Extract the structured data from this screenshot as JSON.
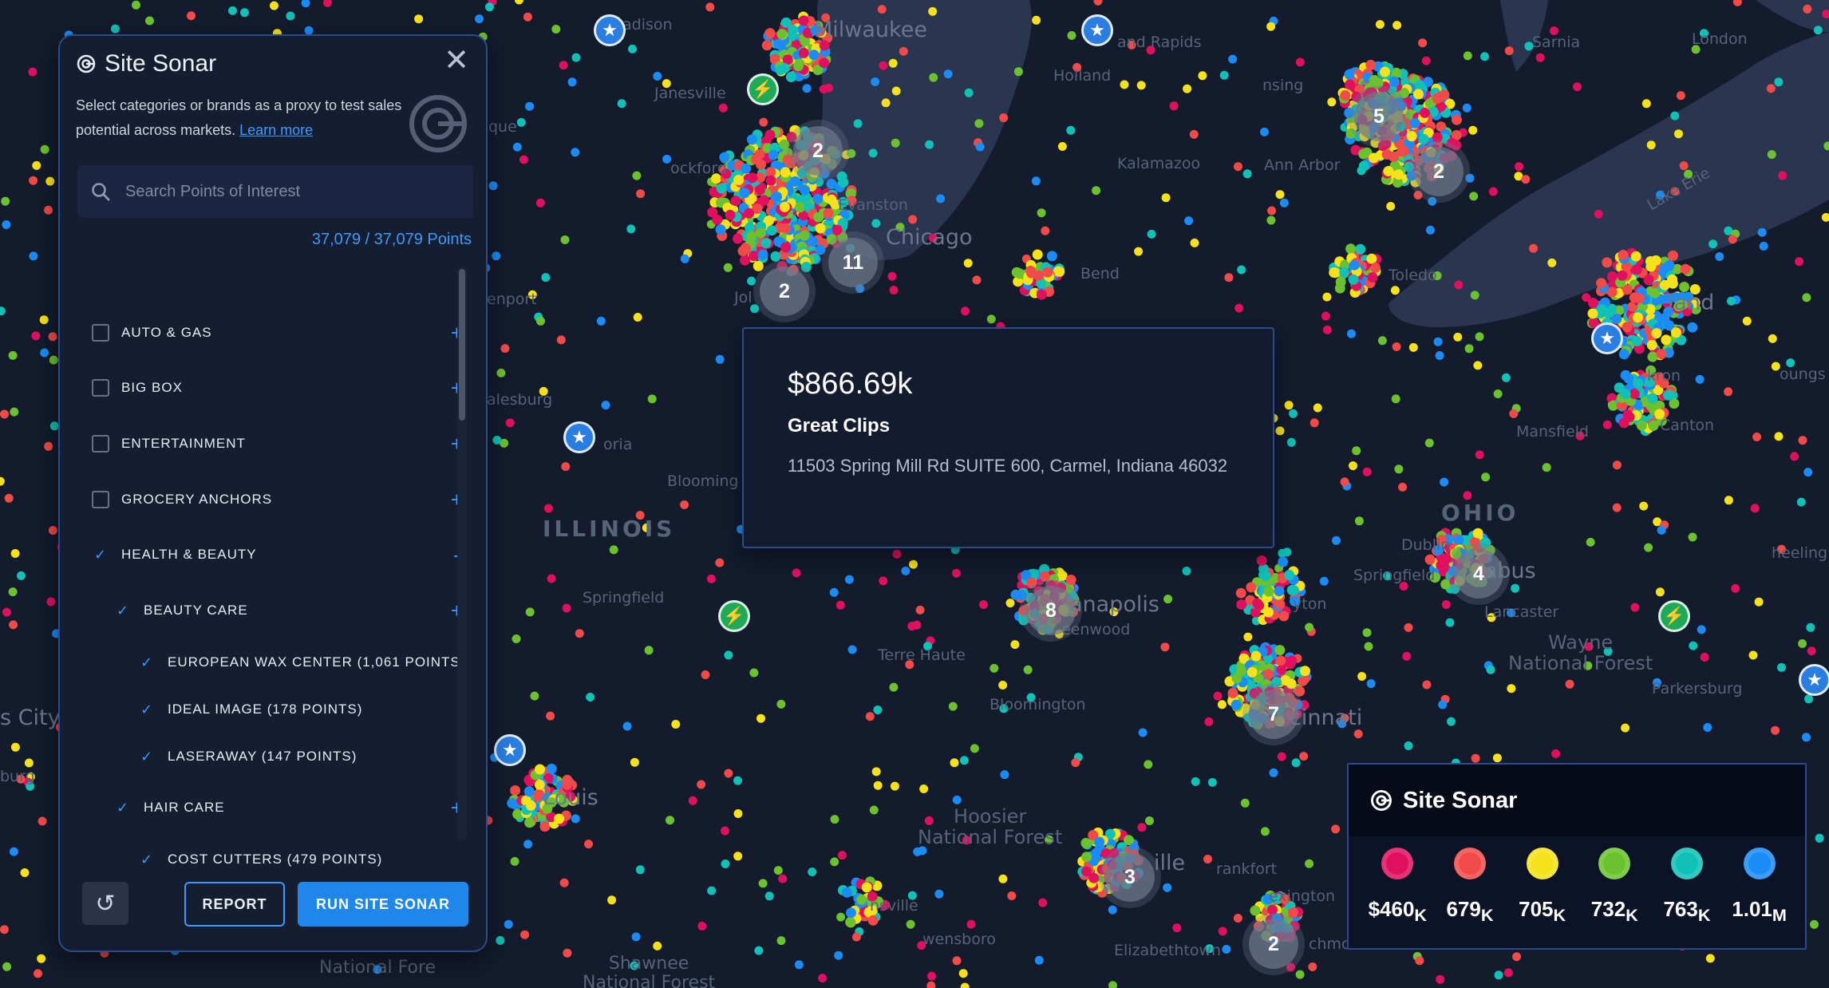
{
  "map": {
    "labels": {
      "milwaukee": "Milwaukee",
      "chicago": "Chicago",
      "evanston": "Evanston",
      "madison": "adison",
      "janesville": "Janesville",
      "rockford": "ockford",
      "grand_rapids": "and Rapids",
      "holland": "Holland",
      "lansing": "nsing",
      "kalamazoo": "Kalamazoo",
      "ann_arbor": "Ann Arbor",
      "sarnia": "Sarnia",
      "london": "London",
      "toledo": "Toledo",
      "cleveland": "land",
      "akron": "kron",
      "canton": "Canton",
      "mansfield": "Mansfield",
      "youngstown": "oungs",
      "wheeling": "heeling",
      "ohio": "OHIO",
      "dublin": "Dublin",
      "columbus": "mbus",
      "springfield_oh": "Springfield",
      "dayton": "yton",
      "lancaster": "Lancaster",
      "wayne_nf": "Wayne\nNational Forest",
      "parkersburg": "Parkersburg",
      "illinois": "ILLINOIS",
      "galesburg": "alesburg",
      "peoria": "oria",
      "bloomington_il": "Blooming",
      "springfield_il": "Springfield",
      "davenport": "enport",
      "st_louis": "Louis",
      "kansas_city": "s City",
      "burg": "burg",
      "indianapolis": "anapolis",
      "greenwood": "eenwood",
      "terre_haute": "Terre Haute",
      "bloomington_in": "Bloomington",
      "hoosier_nf": "Hoosier\nNational Forest",
      "cincinnati": "cinnati",
      "evansville": "nsville",
      "owensboro": "wensboro",
      "elizabethtown": "Elizabethtown",
      "louisville": "ille",
      "frankfort": "rankfort",
      "lexington": "exington",
      "richmond": "chmo",
      "shawnee_nf": "Shawnee\nNational Forest",
      "national_forest": "National Fore",
      "joliet": "Jol",
      "south_bend": "Bend",
      "lake_erie": "Lake Erie",
      "que": "que"
    },
    "clusters": [
      {
        "label": "2",
        "name": "cluster-rockford"
      },
      {
        "label": "11",
        "name": "cluster-chicago"
      },
      {
        "label": "2",
        "name": "cluster-joliet"
      },
      {
        "label": "5",
        "name": "cluster-detroit-north"
      },
      {
        "label": "2",
        "name": "cluster-detroit"
      },
      {
        "label": "4",
        "name": "cluster-columbus"
      },
      {
        "label": "8",
        "name": "cluster-indianapolis"
      },
      {
        "label": "7",
        "name": "cluster-cincinnati"
      },
      {
        "label": "3",
        "name": "cluster-louisville"
      },
      {
        "label": "2",
        "name": "cluster-lexington"
      }
    ],
    "pin_icons": {
      "star": "★",
      "bolt": "⚡"
    }
  },
  "panel": {
    "title": "Site Sonar",
    "close_icon": "✕",
    "description": "Select categories or brands as a proxy to test sales potential across markets.",
    "learn_more": "Learn more",
    "search_placeholder": "Search Points of Interest",
    "points_count": "37,079 / 37,079 Points",
    "check_glyph": "✓",
    "categories": [
      {
        "label": "AUTO & GAS",
        "checked": false,
        "toggle": "+"
      },
      {
        "label": "BIG BOX",
        "checked": false,
        "toggle": "+"
      },
      {
        "label": "ENTERTAINMENT",
        "checked": false,
        "toggle": "+"
      },
      {
        "label": "GROCERY ANCHORS",
        "checked": false,
        "toggle": "+"
      },
      {
        "label": "HEALTH & BEAUTY",
        "checked": true,
        "toggle": "-"
      },
      {
        "label": "BEAUTY CARE",
        "checked": true,
        "toggle": "+"
      },
      {
        "label": "EUROPEAN WAX CENTER (1,061 POINTS)",
        "checked": true,
        "toggle": ""
      },
      {
        "label": "IDEAL IMAGE (178 POINTS)",
        "checked": true,
        "toggle": ""
      },
      {
        "label": "LASERAWAY (147 POINTS)",
        "checked": true,
        "toggle": ""
      },
      {
        "label": "HAIR CARE",
        "checked": true,
        "toggle": "+"
      },
      {
        "label": "COST CUTTERS (479 POINTS)",
        "checked": true,
        "toggle": ""
      }
    ],
    "undo_icon": "↺",
    "report_label": "REPORT",
    "run_label": "RUN SITE SONAR"
  },
  "tooltip": {
    "price": "$866.69k",
    "name": "Great Clips",
    "address": "11503 Spring Mill Rd SUITE 600, Carmel, Indiana 46032"
  },
  "legend": {
    "title": "Site Sonar",
    "items": [
      {
        "color": "#e0105f",
        "value": "$460",
        "unit": "K"
      },
      {
        "color": "#f24a48",
        "value": "679",
        "unit": "K"
      },
      {
        "color": "#f5e21a",
        "value": "705",
        "unit": "K"
      },
      {
        "color": "#6cc22e",
        "value": "732",
        "unit": "K"
      },
      {
        "color": "#0fc1b6",
        "value": "763",
        "unit": "K"
      },
      {
        "color": "#1b8cf6",
        "value": "1.01",
        "unit": "M"
      }
    ]
  },
  "colors": {
    "accent": "#3a9bff",
    "panel_border": "#2a4c8f",
    "map_bg": "#131b2d",
    "water": "#2a3550",
    "dot_palette": [
      "#e0105f",
      "#f24a48",
      "#f5e21a",
      "#6cc22e",
      "#0fc1b6",
      "#1b8cf6"
    ]
  }
}
